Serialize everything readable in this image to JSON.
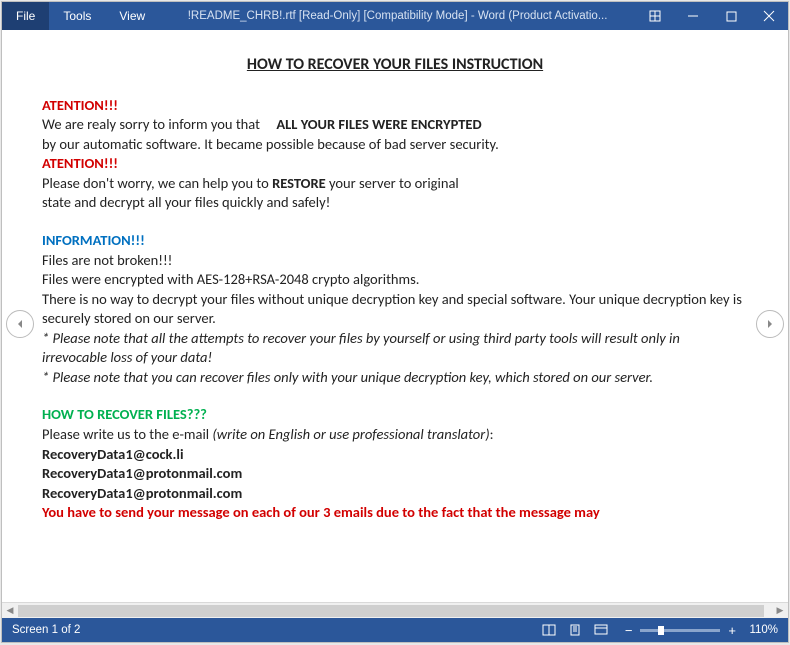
{
  "titlebar": {
    "menu": {
      "file": "File",
      "tools": "Tools",
      "view": "View"
    },
    "title": "!README_CHRB!.rtf [Read-Only] [Compatibility Mode] - Word (Product Activatio..."
  },
  "doc": {
    "heading": "HOW TO RECOVER YOUR FILES INSTRUCTION",
    "att1": "ATENTION!!!",
    "l1a": "We are realy sorry to inform you that ",
    "l1b": "ALL YOUR FILES WERE ENCRYPTED",
    "l2": "by our automatic software. It became possible because of bad server security.",
    "att2": "ATENTION!!!",
    "l3a": "Please don't worry, we can help you to ",
    "l3b": "RESTORE",
    "l3c": " your server to original",
    "l4": "state and decrypt all your files quickly and safely!",
    "info": "INFORMATION!!!",
    "l5": "Files are not broken!!!",
    "l6": "Files were encrypted with AES-128+RSA-2048 crypto algorithms.",
    "l7": "There is no way to decrypt your files without unique decryption key and special software. Your unique decryption key is securely stored on our server.",
    "n1": "* Please note that all the attempts to recover your files by yourself or using third party tools will result only in irrevocable loss of your data!",
    "n2": "* Please note that you can recover files only with your unique decryption key, which stored on our server.",
    "rec": "HOW TO RECOVER FILES???",
    "l8a": "Please write us to the e-mail ",
    "l8b": "(write on English or use professional translator)",
    "l8c": ":",
    "e1": "RecoveryData1@cock.li",
    "e2": "RecoveryData1@protonmail.com",
    "e3": "RecoveryData1@protonmail.com",
    "warn": "You have to send your message on each of our 3 emails due to the fact that the message may"
  },
  "statusbar": {
    "screen": "Screen 1 of 2",
    "zoom": "110%"
  }
}
